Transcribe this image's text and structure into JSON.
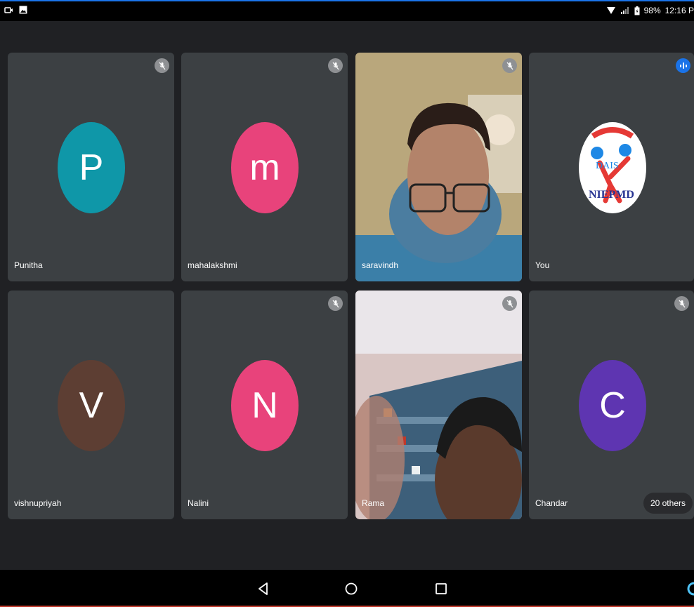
{
  "status_bar": {
    "battery": "98%",
    "time": "12:16 P"
  },
  "participants": [
    {
      "name": "Punitha",
      "initial": "P",
      "color": "#0f97a8",
      "muted": true,
      "video": false
    },
    {
      "name": "mahalakshmi",
      "initial": "m",
      "color": "#e8437b",
      "muted": true,
      "video": false
    },
    {
      "name": "saravindh",
      "initial": "",
      "color": "",
      "muted": true,
      "video": true
    },
    {
      "name": "You",
      "initial": "",
      "color": "",
      "muted": false,
      "video": false,
      "logo_text": "NIEPMD",
      "logo_sub": "DAIS"
    },
    {
      "name": "vishnupriyah",
      "initial": "V",
      "color": "#5d3e33",
      "muted": false,
      "video": false
    },
    {
      "name": "Nalini",
      "initial": "N",
      "color": "#e8437b",
      "muted": true,
      "video": false
    },
    {
      "name": "Rama",
      "initial": "",
      "color": "",
      "muted": true,
      "video": true
    },
    {
      "name": "Chandar",
      "initial": "C",
      "color": "#5e35b1",
      "muted": true,
      "video": false
    }
  ],
  "others_label": "20 others",
  "colors": {
    "background": "#202124",
    "tile": "#3c4043",
    "accent": "#1a73e8"
  }
}
